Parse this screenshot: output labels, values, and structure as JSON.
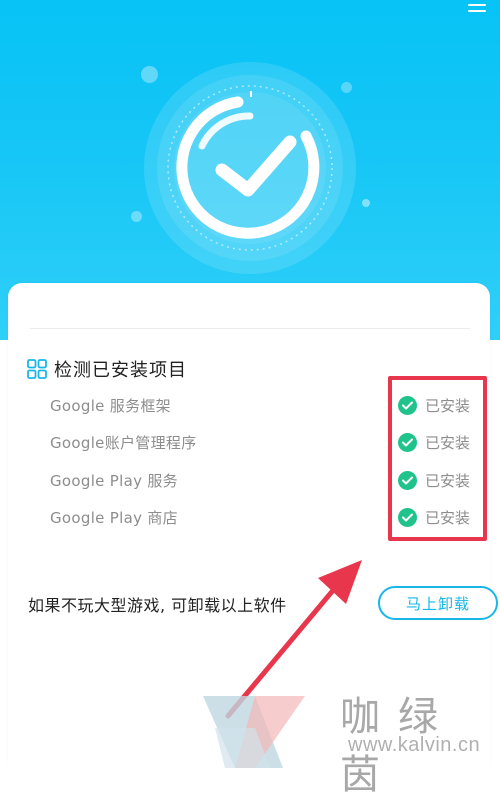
{
  "hero": {
    "icon": "clock-check-icon",
    "menu_icon": "menu-icon"
  },
  "section": {
    "title": "检测已安装项目",
    "icon": "grid-icon"
  },
  "items": [
    {
      "name": "Google 服务框架",
      "status": "已安装"
    },
    {
      "name": "Google账户管理程序",
      "status": "已安装"
    },
    {
      "name": "Google Play 服务",
      "status": "已安装"
    },
    {
      "name": "Google Play 商店",
      "status": "已安装"
    }
  ],
  "uninstall": {
    "text": "如果不玩大型游戏, 可卸载以上软件",
    "button": "马上卸载"
  },
  "watermark": {
    "brand": "咖绿茵",
    "url": "www.kalvin.cn"
  },
  "colors": {
    "accent": "#19b7e8",
    "hero": "#07c3f6",
    "status_ok": "#21c38d",
    "highlight": "#e8364c"
  }
}
